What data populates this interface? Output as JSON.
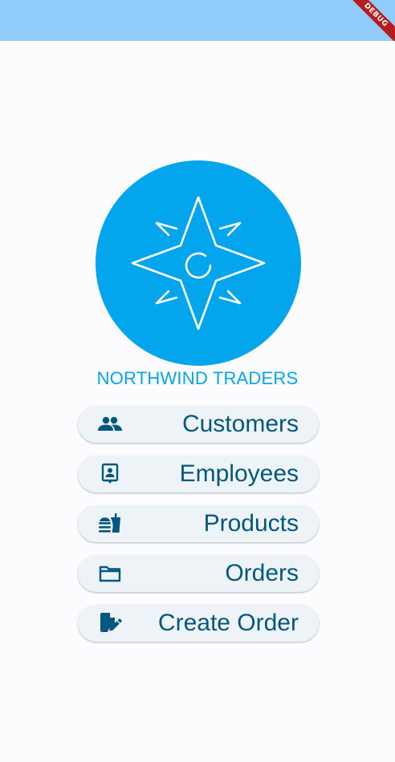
{
  "app": {
    "brand_name": "NORTHWIND TRADERS",
    "debug_banner": "DEBUG",
    "colors": {
      "status_bar": "#90cdfd",
      "accent": "#03a6ed",
      "button_text": "#04577f",
      "button_bg": "#eef3f8",
      "background": "#fcfcff"
    }
  },
  "logo": {
    "icon": "compass-star-icon"
  },
  "menu": {
    "items": [
      {
        "label": "Customers",
        "icon": "people-icon"
      },
      {
        "label": "Employees",
        "icon": "contact-badge-icon"
      },
      {
        "label": "Products",
        "icon": "fastfood-icon"
      },
      {
        "label": "Orders",
        "icon": "folder-icon"
      },
      {
        "label": "Create Order",
        "icon": "edit-document-icon"
      }
    ]
  }
}
